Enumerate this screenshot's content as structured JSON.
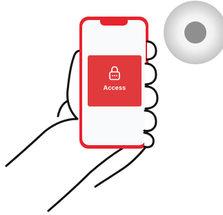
{
  "access_card": {
    "label": "Access",
    "icon": "lock-icon"
  },
  "nfc_tag": {
    "icon": "nfc-reader-icon"
  },
  "colors": {
    "phone_frame": "#e8232e",
    "access_card_bg": "#e13a3c",
    "screen_bg": "#f9fafb",
    "hand_outline": "#111111",
    "reader_outer": "#c9c9c9",
    "reader_center": "#8c8c8c"
  }
}
